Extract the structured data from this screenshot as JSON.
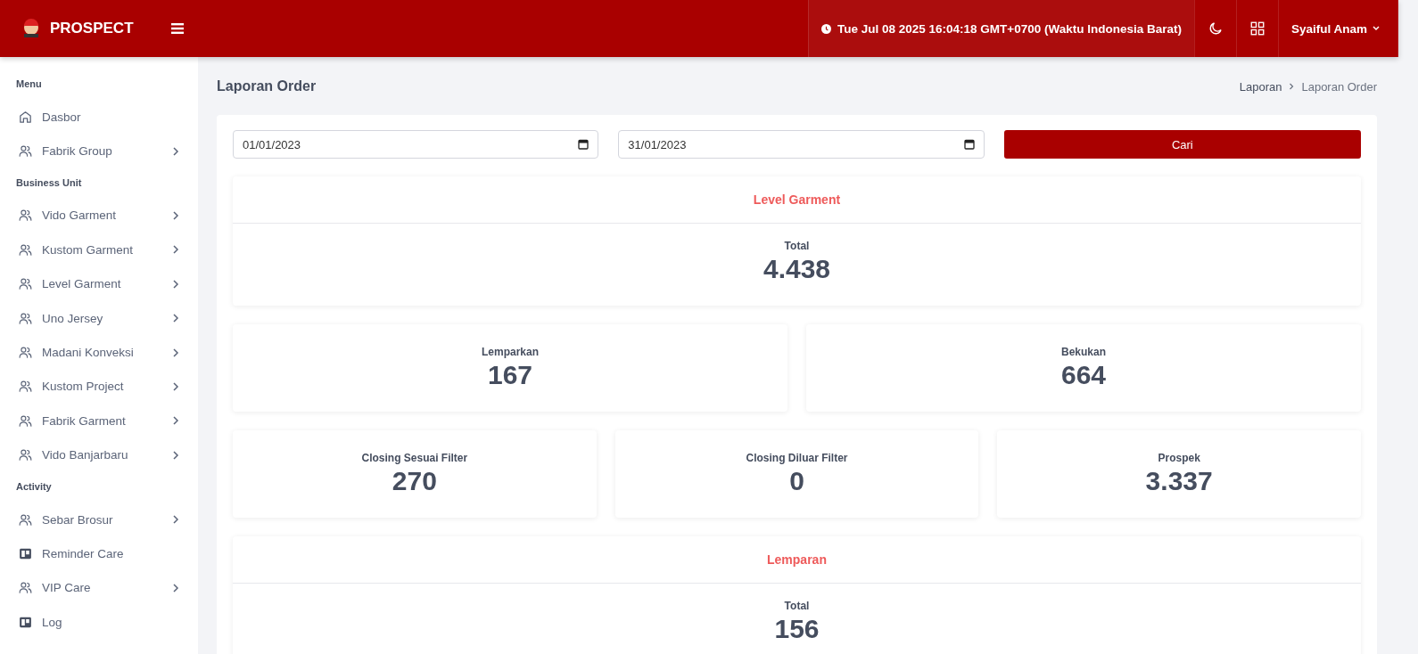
{
  "header": {
    "brand": "PROSPECT",
    "datetime": "Tue Jul 08 2025 16:04:18 GMT+0700 (Waktu Indonesia Barat)",
    "user": "Syaiful Anam"
  },
  "sidebar": {
    "groups": [
      {
        "heading": "Menu",
        "items": [
          {
            "label": "Dasbor",
            "kind": "home",
            "has_children": false
          },
          {
            "label": "Fabrik Group",
            "kind": "users",
            "has_children": true
          }
        ]
      },
      {
        "heading": "Business Unit",
        "items": [
          {
            "label": "Vido Garment",
            "kind": "users",
            "has_children": true
          },
          {
            "label": "Kustom Garment",
            "kind": "users",
            "has_children": true
          },
          {
            "label": "Level Garment",
            "kind": "users",
            "has_children": true
          },
          {
            "label": "Uno Jersey",
            "kind": "users",
            "has_children": true
          },
          {
            "label": "Madani Konveksi",
            "kind": "users",
            "has_children": true
          },
          {
            "label": "Kustom Project",
            "kind": "users",
            "has_children": true
          },
          {
            "label": "Fabrik Garment",
            "kind": "users",
            "has_children": true
          },
          {
            "label": "Vido Banjarbaru",
            "kind": "users",
            "has_children": true
          }
        ]
      },
      {
        "heading": "Activity",
        "items": [
          {
            "label": "Sebar Brosur",
            "kind": "users",
            "has_children": true
          },
          {
            "label": "Reminder Care",
            "kind": "board",
            "has_children": false
          },
          {
            "label": "VIP Care",
            "kind": "users",
            "has_children": true
          },
          {
            "label": "Log",
            "kind": "board",
            "has_children": false
          }
        ]
      }
    ]
  },
  "page_title": "Laporan Order",
  "breadcrumb": [
    "Laporan",
    "Laporan Order"
  ],
  "filter": {
    "start_date": "01/01/2023",
    "end_date": "31/01/2023",
    "button": "Cari"
  },
  "sections": [
    {
      "title": "Level Garment",
      "total_label": "Total",
      "total_value": "4.438",
      "rows": [
        [
          {
            "label": "Lemparkan",
            "value": "167"
          },
          {
            "label": "Bekukan",
            "value": "664"
          }
        ],
        [
          {
            "label": "Closing Sesuai Filter",
            "value": "270"
          },
          {
            "label": "Closing Diluar Filter",
            "value": "0"
          },
          {
            "label": "Prospek",
            "value": "3.337"
          }
        ]
      ]
    },
    {
      "title": "Lemparan",
      "total_label": "Total",
      "total_value": "156"
    }
  ]
}
